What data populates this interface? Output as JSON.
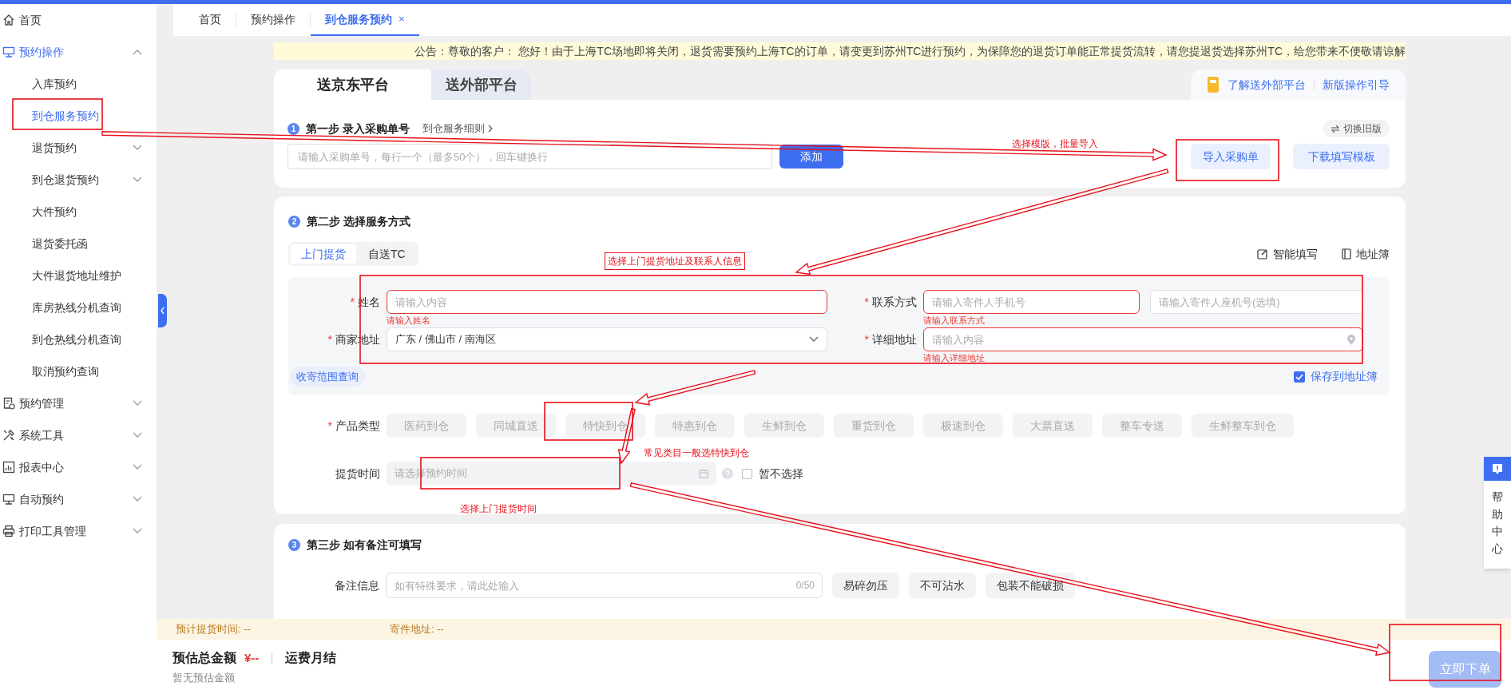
{
  "sidebar": {
    "items": [
      {
        "label": "首页",
        "kind": "link",
        "selected": false
      },
      {
        "label": "预约操作",
        "kind": "group",
        "selected": true,
        "expanded": true,
        "children": [
          {
            "label": "入库预约",
            "kind": "link",
            "selected": false
          },
          {
            "label": "到仓服务预约",
            "kind": "link",
            "selected": true
          },
          {
            "label": "退货预约",
            "kind": "group",
            "selected": false,
            "expanded": false
          },
          {
            "label": "到仓退货预约",
            "kind": "group",
            "selected": false,
            "expanded": false
          },
          {
            "label": "大件预约",
            "kind": "link",
            "selected": false
          },
          {
            "label": "退货委托函",
            "kind": "link",
            "selected": false
          },
          {
            "label": "大件退货地址维护",
            "kind": "link",
            "selected": false
          },
          {
            "label": "库房热线分机查询",
            "kind": "link",
            "selected": false
          },
          {
            "label": "到仓热线分机查询",
            "kind": "link",
            "selected": false
          },
          {
            "label": "取消预约查询",
            "kind": "link",
            "selected": false
          }
        ]
      },
      {
        "label": "预约管理",
        "kind": "group",
        "selected": false,
        "expanded": false
      },
      {
        "label": "系统工具",
        "kind": "group",
        "selected": false,
        "expanded": false
      },
      {
        "label": "报表中心",
        "kind": "group",
        "selected": false,
        "expanded": false
      },
      {
        "label": "自动预约",
        "kind": "group",
        "selected": false,
        "expanded": false
      },
      {
        "label": "打印工具管理",
        "kind": "group",
        "selected": false,
        "expanded": false
      }
    ]
  },
  "tabs": [
    {
      "label": "首页",
      "selected": false
    },
    {
      "label": "预约操作",
      "selected": false
    },
    {
      "label": "到仓服务预约",
      "selected": true,
      "close": "×"
    }
  ],
  "notice": "公告：尊敬的客户：  您好！由于上海TC场地即将关闭，退货需要预约上海TC的订单，请变更到苏州TC进行预约，为保障您的退货订单能正常提货流转，请您提退货选择苏州TC，给您带来不便敬请谅解",
  "platform_tabs": [
    {
      "label": "送京东平台",
      "selected": true
    },
    {
      "label": "送外部平台",
      "selected": false
    }
  ],
  "platform_links": [
    "了解送外部平台",
    "新版操作引导"
  ],
  "step1": {
    "badge": "1",
    "title": "第一步 录入采购单号",
    "link": "到仓服务细则",
    "switch_button": "切换旧版",
    "input_placeholder": "请输入采购单号，每行一个（最多50个），回车键换行",
    "add_button": "添加",
    "import_button": "导入采购单",
    "download_button": "下载填写模板"
  },
  "step2": {
    "badge": "2",
    "title": "第二步 选择服务方式",
    "mode_tabs": [
      {
        "label": "上门提货",
        "selected": true
      },
      {
        "label": "自送TC",
        "selected": false
      }
    ],
    "actions": [
      "智能填写",
      "地址簿"
    ],
    "name": {
      "label": "姓名",
      "required_mark": "*",
      "placeholder": "请输入内容",
      "error": "请输入姓名"
    },
    "contact": {
      "label": "联系方式",
      "required_mark": "*",
      "placeholder": "请输入寄件人手机号",
      "placeholder_2": "请输入寄件人座机号(选填)",
      "error": "请输入联系方式"
    },
    "merchant_address": {
      "label": "商家地址",
      "required_mark": "*",
      "value": "广东 / 佛山市 / 南海区"
    },
    "detail_address": {
      "label": "详细地址",
      "required_mark": "*",
      "placeholder": "请输入内容",
      "error": "请输入详细地址"
    },
    "range_query": "收寄范围查询",
    "save_address": {
      "label": "保存到地址簿",
      "checked": true
    },
    "product_type": {
      "label": "产品类型",
      "required_mark": "*",
      "options": [
        {
          "label": "医药到仓",
          "disabled": true
        },
        {
          "label": "同城直送",
          "disabled": true
        },
        {
          "label": "特快到仓",
          "disabled": true
        },
        {
          "label": "特惠到仓",
          "disabled": true
        },
        {
          "label": "生鲜到仓",
          "disabled": true
        },
        {
          "label": "重货到仓",
          "disabled": true
        },
        {
          "label": "极速到仓",
          "disabled": true
        },
        {
          "label": "大票直送",
          "disabled": true
        },
        {
          "label": "整车专送",
          "disabled": true
        },
        {
          "label": "生鲜整车到仓",
          "disabled": true
        }
      ]
    },
    "pickup_time": {
      "label": "提货时间",
      "placeholder": "请选择预约时间",
      "disabled": true,
      "skip_label": "暂不选择",
      "skip_checked": false
    }
  },
  "step3": {
    "badge": "3",
    "title": "第三步 如有备注可填写",
    "remark": {
      "label": "备注信息",
      "placeholder": "如有特殊要求，请此处输入",
      "counter": "0/50",
      "chips": [
        "易碎勿压",
        "不可沾水",
        "包装不能破损"
      ]
    }
  },
  "footer": {
    "pickup_estimate": "预计提货时间: --",
    "sender_address": "寄件地址: --",
    "total_label": "预估总金额",
    "total_value": "¥--",
    "billing": "运费月结",
    "estimate_note": "暂无预估金额",
    "submit_button": "立即下单"
  },
  "help_center": "帮助中心",
  "annotations": [
    {
      "text": "选择模版，批量导入"
    },
    {
      "text": "选择上门提货地址及联系人信息"
    },
    {
      "text": "常见类目一般选特快到仓"
    },
    {
      "text": "选择上门提货时间"
    }
  ]
}
